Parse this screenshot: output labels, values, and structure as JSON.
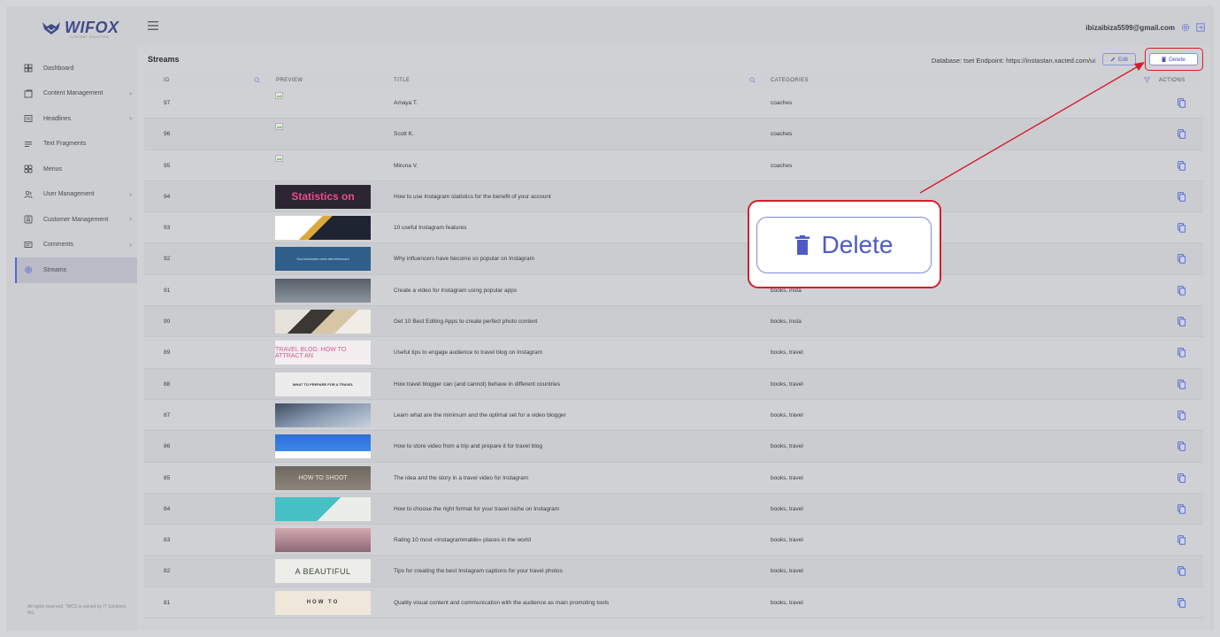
{
  "brand": {
    "name": "WIFOX",
    "tagline": "CONTENT SOLUTION"
  },
  "sidebar": {
    "items": [
      {
        "label": "Dashboard",
        "icon": "dashboard-icon",
        "has_children": false,
        "active": false
      },
      {
        "label": "Content Management",
        "icon": "content-icon",
        "has_children": true,
        "active": false
      },
      {
        "label": "Headlines",
        "icon": "headlines-icon",
        "has_children": true,
        "active": false
      },
      {
        "label": "Text Fragments",
        "icon": "text-fragments-icon",
        "has_children": false,
        "active": false
      },
      {
        "label": "Menus",
        "icon": "menus-icon",
        "has_children": false,
        "active": false
      },
      {
        "label": "User Management",
        "icon": "users-icon",
        "has_children": true,
        "active": false
      },
      {
        "label": "Customer Management",
        "icon": "customers-icon",
        "has_children": true,
        "active": false
      },
      {
        "label": "Comments",
        "icon": "comments-icon",
        "has_children": true,
        "active": false
      },
      {
        "label": "Streams",
        "icon": "streams-icon",
        "has_children": false,
        "active": true
      }
    ],
    "footer": "All rights reserved. \"WCS is owned by IT Solutions AG."
  },
  "header": {
    "user_email": "ibizaibiza5599@gmail.com"
  },
  "main": {
    "title": "Streams",
    "meta": "Database: tset   Endpoint: https://instastan.xacted.com/ui",
    "edit_label": "Edit",
    "delete_label": "Delete"
  },
  "table": {
    "columns": {
      "id": "ID",
      "preview": "PREVIEW",
      "title": "TITLE",
      "categories": "CATEGORIES",
      "actions": "ACTIONS"
    },
    "rows": [
      {
        "id": "97",
        "title": "Amaya T.",
        "categories": "coaches",
        "preview": "broken",
        "preview_text": ""
      },
      {
        "id": "96",
        "title": "Scott K.",
        "categories": "coaches",
        "preview": "broken",
        "preview_text": ""
      },
      {
        "id": "95",
        "title": "Miruna V.",
        "categories": "coaches",
        "preview": "broken",
        "preview_text": ""
      },
      {
        "id": "94",
        "title": "How to use Instagram statistics for the benefit of your account",
        "categories": "",
        "preview": "stats",
        "preview_text": "Statistics on"
      },
      {
        "id": "93",
        "title": "10 useful Instagram features",
        "categories": "",
        "preview": "stripe",
        "preview_text": ""
      },
      {
        "id": "92",
        "title": "Why influencers have become so popular on Instagram",
        "categories": "",
        "preview": "blue",
        "preview_text": "How businesses work with influencers"
      },
      {
        "id": "91",
        "title": "Create a video for Instagram using popular apps",
        "categories": "books, insta",
        "preview": "gray",
        "preview_text": ""
      },
      {
        "id": "90",
        "title": "Get 10 Best Editing Apps to create perfect photo content",
        "categories": "books, insta",
        "preview": "desk",
        "preview_text": ""
      },
      {
        "id": "89",
        "title": "Useful tips to engage audience to travel blog on Instagram",
        "categories": "books, travel",
        "preview": "pinktext",
        "preview_text": "TRAVEL BLOG: HOW TO ATTRACT AN"
      },
      {
        "id": "88",
        "title": "How travel blogger can (and cannot) behave in different countries",
        "categories": "books, travel",
        "preview": "whitetext",
        "preview_text": "WHAT TO PREPARE FOR A TRAVEL"
      },
      {
        "id": "87",
        "title": "Learn what are the minimum and the optimal set for a video blogger",
        "categories": "books, travel",
        "preview": "mountain",
        "preview_text": ""
      },
      {
        "id": "86",
        "title": "How to store video from a trip and prepare it for travel blog",
        "categories": "books, travel",
        "preview": "sea",
        "preview_text": ""
      },
      {
        "id": "85",
        "title": "The idea and the story in a travel video for Instagram",
        "categories": "books, travel",
        "preview": "shoot",
        "preview_text": "HOW TO SHOOT"
      },
      {
        "id": "84",
        "title": "How to choose the right format for your travel niche on Instagram",
        "categories": "books, travel",
        "preview": "teal",
        "preview_text": ""
      },
      {
        "id": "83",
        "title": "Rating 10 most «Instagrammable» places in the world",
        "categories": "books, travel",
        "preview": "sunset",
        "preview_text": ""
      },
      {
        "id": "82",
        "title": "Tips for creating the best Instagram captions for your travel photos",
        "categories": "books, travel",
        "preview": "beautiful",
        "preview_text": "A BEAUTIFUL"
      },
      {
        "id": "81",
        "title": "Quality visual content and communication with the audience as main promoting tools",
        "categories": "books, travel",
        "preview": "howto",
        "preview_text": "HOW TO"
      }
    ]
  },
  "callout": {
    "label": "Delete"
  },
  "colors": {
    "accent": "#5468d4",
    "highlight": "#d51d2b"
  }
}
